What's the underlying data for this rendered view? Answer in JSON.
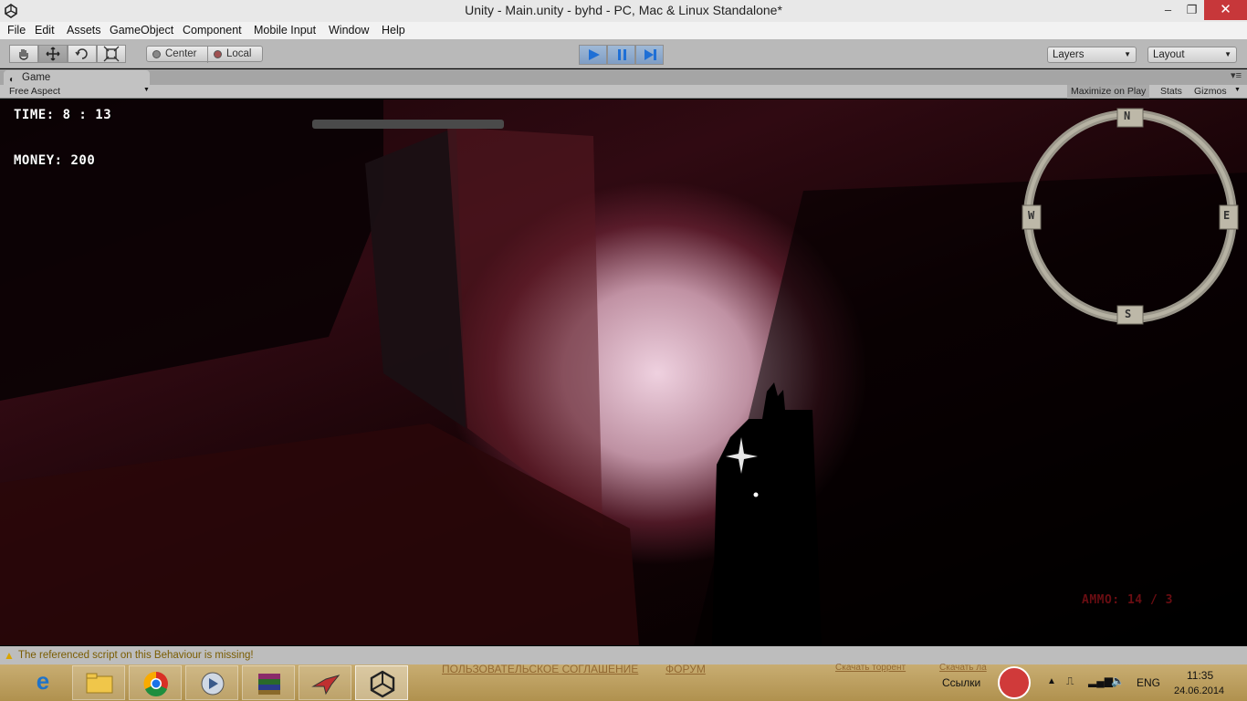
{
  "window": {
    "title": "Unity - Main.unity - byhd - PC, Mac & Linux Standalone*",
    "minimize": "‒",
    "maximize": "❐",
    "close": "✕"
  },
  "menu": [
    "File",
    "Edit",
    "Assets",
    "GameObject",
    "Component",
    "Mobile Input",
    "Window",
    "Help"
  ],
  "toolbar": {
    "pivot_center": "Center",
    "pivot_local": "Local",
    "layers": "Layers",
    "layout": "Layout"
  },
  "game_view": {
    "tab": "Game",
    "aspect": "Free Aspect",
    "maximize_on_play": "Maximize on Play",
    "stats": "Stats",
    "gizmos": "Gizmos"
  },
  "hud": {
    "time": "TIME: 8 : 13",
    "money": "MONEY: 200",
    "ammo": "AMMO: 14 / 3",
    "compass": {
      "n": "N",
      "w": "W",
      "e": "E",
      "s": "S"
    }
  },
  "status": {
    "message": "The referenced script on this Behaviour is missing!"
  },
  "taskbar": {
    "bg_links": [
      "ПОЛЬЗОВАТЕЛЬСКОЕ СОГЛАШЕНИЕ",
      "ФОРУМ",
      "Скачать торрент",
      "Скачать ла"
    ],
    "links_label": "Ссылки",
    "lang": "ENG",
    "time": "11:35",
    "date": "24.06.2014"
  },
  "colors": {
    "accent_play": "#3f82d6",
    "close_button": "#c7373a",
    "warning": "#d9a400",
    "ammo_text": "#6a0d12"
  }
}
